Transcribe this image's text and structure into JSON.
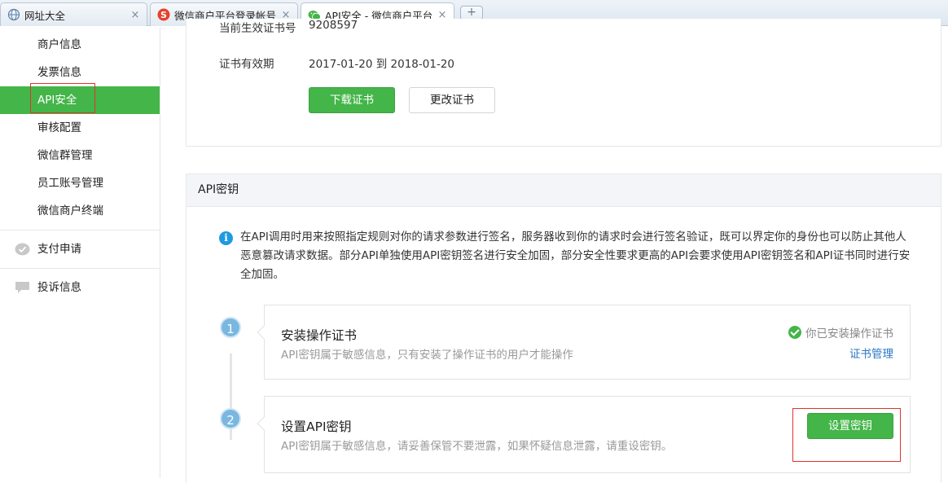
{
  "browser": {
    "tabs": [
      {
        "label": "网址大全",
        "close": "×"
      },
      {
        "label": "微信商户平台登录帐号 -",
        "close": "×"
      },
      {
        "label": "API安全 - 微信商户平台",
        "close": "×"
      }
    ],
    "new_tab": "+"
  },
  "sidebar": {
    "items": [
      {
        "label": "商户信息"
      },
      {
        "label": "发票信息"
      },
      {
        "label": "API安全"
      },
      {
        "label": "审核配置"
      },
      {
        "label": "微信群管理"
      },
      {
        "label": "员工账号管理"
      },
      {
        "label": "微信商户终端"
      }
    ],
    "groups": [
      {
        "label": "支付申请",
        "icon": "payment-icon"
      },
      {
        "label": "投诉信息",
        "icon": "comment-icon"
      }
    ]
  },
  "cert": {
    "current_label": "当前生效证书号",
    "current_value": "9208597",
    "validity_label": "证书有效期",
    "validity_value": "2017-01-20  到  2018-01-20",
    "download_button": "下载证书",
    "change_button": "更改证书"
  },
  "api_key": {
    "title": "API密钥",
    "info_icon_glyph": "i",
    "info_text": "在API调用时用来按照指定规则对你的请求参数进行签名，服务器收到你的请求时会进行签名验证，既可以界定你的身份也可以防止其他人恶意篡改请求数据。部分API单独使用API密钥签名进行安全加固，部分安全性要求更高的API会要求使用API密钥签名和API证书同时进行安全加固。",
    "steps": [
      {
        "number": "1",
        "title": "安装操作证书",
        "desc": "API密钥属于敏感信息，只有安装了操作证书的用户才能操作",
        "status": "你已安装操作证书",
        "link": "证书管理"
      },
      {
        "number": "2",
        "title": "设置API密钥",
        "desc": "API密钥属于敏感信息，请妥善保管不要泄露，如果怀疑信息泄露，请重设密钥。",
        "button": "设置密钥"
      }
    ]
  },
  "colors": {
    "accent_green": "#44b549",
    "highlight_red": "#e0332e",
    "link_blue": "#2a76c6",
    "step_blue": "#7ab7e0"
  }
}
